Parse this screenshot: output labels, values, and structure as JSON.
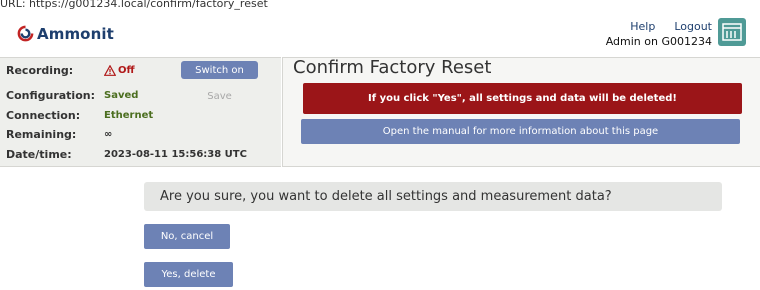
{
  "browser": {
    "url_text": "URL: https://g001234.local/confirm/factory_reset"
  },
  "brand": {
    "name": "Ammonit",
    "color": "#1e3f6e"
  },
  "header": {
    "help": "Help",
    "logout": "Logout",
    "user_line": "Admin on G001234",
    "sync_icon": "sync-icon"
  },
  "status": {
    "recording_label": "Recording:",
    "recording_value": "Off",
    "recording_icon": "warning-icon",
    "switch_on": "Switch on",
    "configuration_label": "Configuration:",
    "configuration_value": "Saved",
    "save": "Save",
    "connection_label": "Connection:",
    "connection_value": "Ethernet",
    "remaining_label": "Remaining:",
    "remaining_value": "∞",
    "datetime_label": "Date/time:",
    "datetime_value": "2023-08-11 15:56:38 UTC"
  },
  "main": {
    "title": "Confirm Factory Reset",
    "warning": "If you click \"Yes\", all settings and data will be deleted!",
    "manual": "Open the manual for more information about this page",
    "question": "Are you sure, you want to delete all settings and measurement data?",
    "cancel": "No, cancel",
    "yes": "Yes, delete"
  },
  "colors": {
    "accent": "#6d82b5",
    "danger": "#9b1518",
    "ok": "#4b6e1f",
    "off": "#b01818",
    "sync": "#4f9a96"
  }
}
